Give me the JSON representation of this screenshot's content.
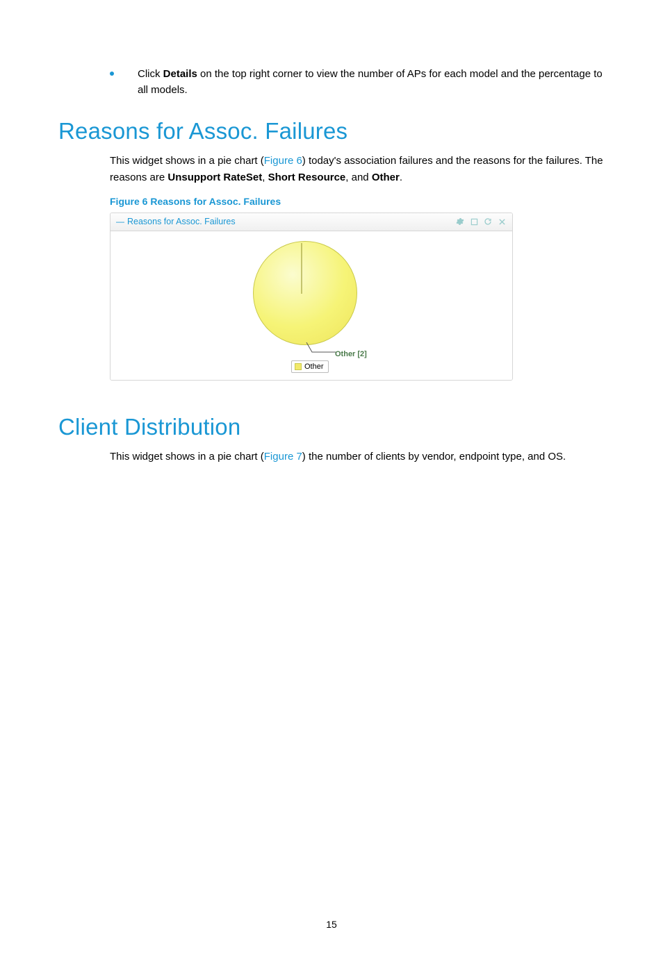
{
  "bullet": {
    "prefix": "Click ",
    "bold": "Details",
    "rest": " on the top right corner to view the number of APs for each model and the percentage to all models."
  },
  "section1": {
    "heading": "Reasons for Assoc. Failures",
    "para_pre": "This widget shows in a pie chart (",
    "para_link": "Figure 6",
    "para_mid": ") today's association failures and the reasons for the failures. The reasons are ",
    "bold1": "Unsupport RateSet",
    "sep1": ", ",
    "bold2": "Short Resource",
    "sep2": ", and ",
    "bold3": "Other",
    "para_end": ".",
    "figure_caption": "Figure 6 Reasons for Assoc. Failures"
  },
  "widget": {
    "collapse": "—",
    "title": "Reasons for Assoc. Failures",
    "callout": "Other [2]",
    "legend": "Other"
  },
  "section2": {
    "heading": "Client Distribution",
    "para_pre": "This widget shows in a pie chart (",
    "para_link": "Figure 7",
    "para_end": ") the number of clients by vendor, endpoint type, and OS."
  },
  "page_number": "15",
  "chart_data": {
    "type": "pie",
    "title": "Reasons for Assoc. Failures",
    "series": [
      {
        "name": "Other",
        "value": 2
      }
    ],
    "legend": [
      "Other"
    ]
  }
}
